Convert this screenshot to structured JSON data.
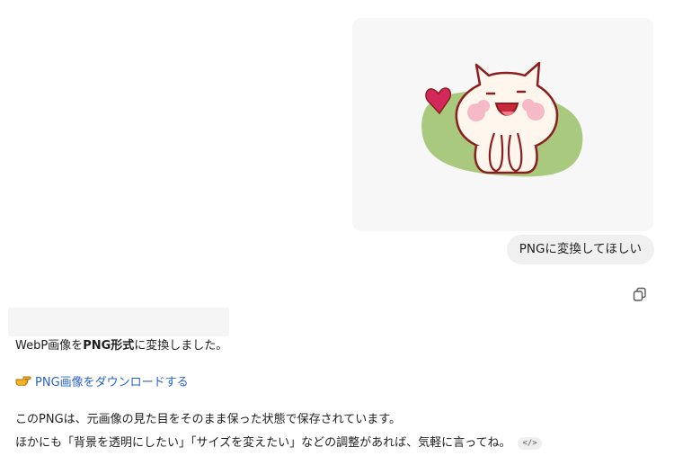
{
  "image": {
    "subject": "cat-character-illustration"
  },
  "user_message": {
    "text": "PNGに変換してほしい"
  },
  "assistant": {
    "line1_pre": "WebP画像を",
    "line1_bold": "PNG形式",
    "line1_post": "に変換しました。",
    "download_link": "PNG画像をダウンロードする",
    "line3": "このPNGは、元画像の見た目をそのまま保った状態で保存されています。",
    "line4": "ほかにも「背景を透明にしたい」「サイズを変えたい」などの調整があれば、気軽に言ってね。",
    "code_chip": "</>"
  },
  "icons": {
    "copy": "copy-icon",
    "pointing_hand": "pointing-hand-icon"
  },
  "colors": {
    "link": "#2a64c3",
    "blob": "#a9c97e",
    "heart": "#d3285a",
    "outline": "#8b1e1e"
  }
}
